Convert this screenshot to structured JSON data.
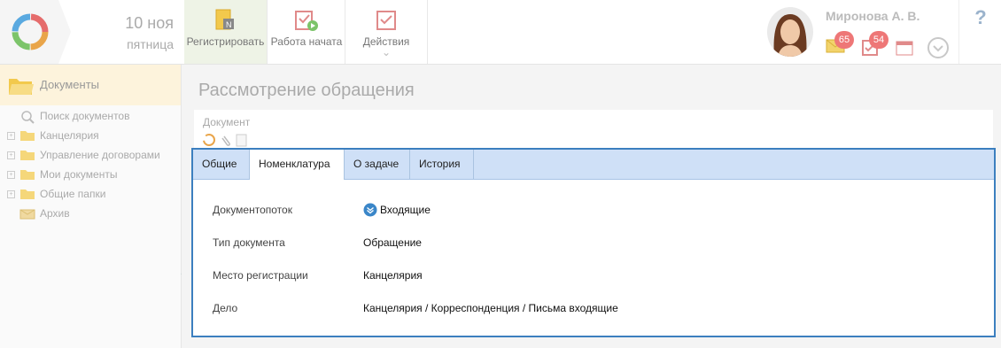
{
  "header": {
    "date_day": "10 ноя",
    "date_weekday": "пятница",
    "toolbar": {
      "register_label": "Регистрировать",
      "work_started_label": "Работа начата",
      "actions_label": "Действия"
    },
    "user": {
      "name": "Миронова А. В.",
      "mail_count": "65",
      "tasks_count": "54"
    },
    "help_label": "?"
  },
  "sidebar": {
    "title": "Документы",
    "items": [
      {
        "label": "Поиск документов",
        "icon": "search-icon"
      },
      {
        "label": "Канцелярия",
        "icon": "folder-icon"
      },
      {
        "label": "Управление договорами",
        "icon": "folder-icon"
      },
      {
        "label": "Мои документы",
        "icon": "folder-icon"
      },
      {
        "label": "Общие папки",
        "icon": "folder-icon"
      },
      {
        "label": "Архив",
        "icon": "archive-icon"
      }
    ]
  },
  "main": {
    "title": "Рассмотрение обращения",
    "document_label": "Документ",
    "tabs": [
      {
        "label": "Общие"
      },
      {
        "label": "Номенклатура",
        "active": true
      },
      {
        "label": "О задаче"
      },
      {
        "label": "История"
      }
    ],
    "fields": [
      {
        "label": "Документопоток",
        "value": "Входящие",
        "icon": "chevron-circle-icon"
      },
      {
        "label": "Тип документа",
        "value": "Обращение"
      },
      {
        "label": "Место регистрации",
        "value": "Канцелярия"
      },
      {
        "label": "Дело",
        "value": "Канцелярия / Корреспонденция / Письма входящие"
      }
    ]
  },
  "colors": {
    "accent_blue": "#3c7fbf",
    "tab_strip": "#cfe0f7",
    "badge": "#e77777",
    "sidebar_header": "#fdf3dc"
  }
}
